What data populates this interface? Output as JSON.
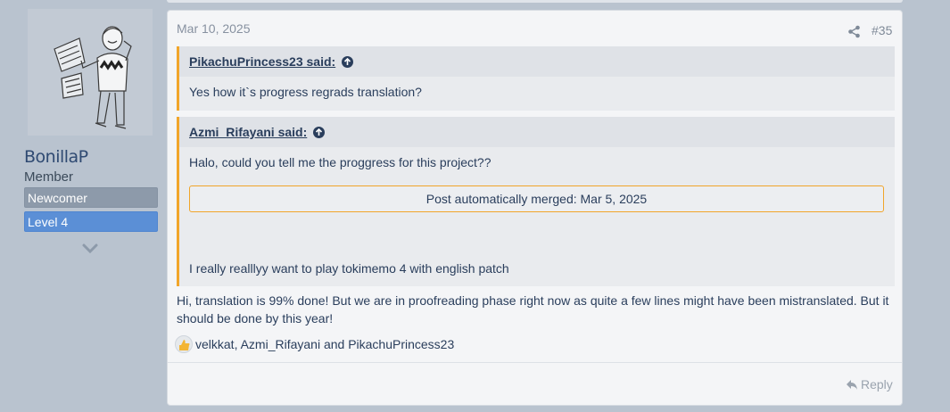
{
  "user": {
    "name": "BonillaP",
    "title": "Member",
    "banners": [
      "Newcomer",
      "Level 4"
    ]
  },
  "post": {
    "date": "Mar 10, 2025",
    "number": "#35",
    "quotes": [
      {
        "author": "PikachuPrincess23 said:",
        "text": "Yes how it`s progress regrads translation?"
      },
      {
        "author": "Azmi_Rifayani said:",
        "text": "Halo, could you tell me the proggress for this project??",
        "merged": "Post automatically merged: Mar 5, 2025",
        "text2": "I really realllyy want to play tokimemo 4 with english patch"
      }
    ],
    "body": "Hi, translation is 99% done! But we are in proofreading phase right now as quite a few lines might have been mistranslated. But it should be done by this year!",
    "reactions": "velkkat, Azmi_Rifayani and PikachuPrincess23",
    "reply_label": "Reply"
  },
  "colors": {
    "accent": "#f1a52a",
    "link": "#2a3e5c",
    "banner_newcomer": "#8d9aaa",
    "banner_level": "#5b8fd6"
  },
  "icons": [
    "share-icon",
    "arrow-up-icon",
    "like-icon",
    "reply-icon",
    "chevron-down-icon"
  ]
}
